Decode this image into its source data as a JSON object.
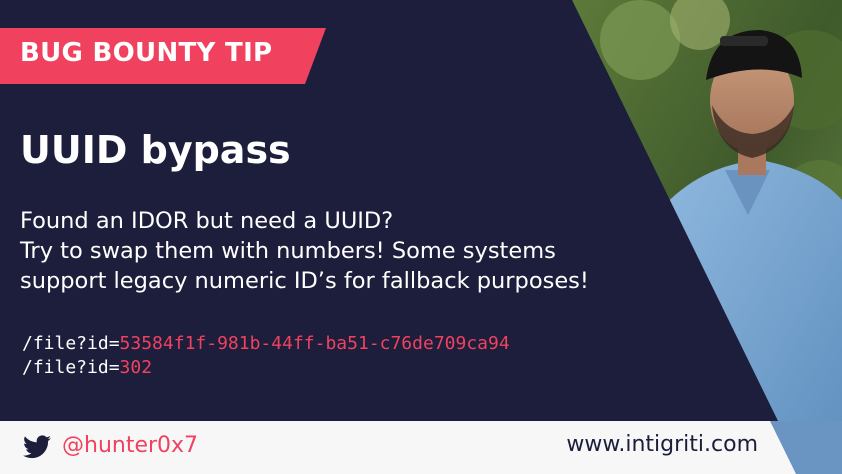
{
  "badge": {
    "label": "BUG BOUNTY TIP"
  },
  "title": "UUID bypass",
  "body": {
    "lines": [
      "Found an IDOR but need a UUID?",
      "Try to swap them with numbers! Some systems",
      "support legacy numeric ID’s for fallback purposes!"
    ]
  },
  "code": [
    {
      "prefix": "/file?id=",
      "value": "53584f1f-981b-44ff-ba51-c76de709ca94"
    },
    {
      "prefix": "/file?id=",
      "value": "302"
    }
  ],
  "footer": {
    "handle": "@hunter0x7",
    "website": "www.intigriti.com"
  },
  "colors": {
    "background": "#1c1e3b",
    "accent": "#f0425f",
    "footer_bg": "#f7f7f8"
  },
  "icons": {
    "social": "twitter-bird-icon"
  }
}
